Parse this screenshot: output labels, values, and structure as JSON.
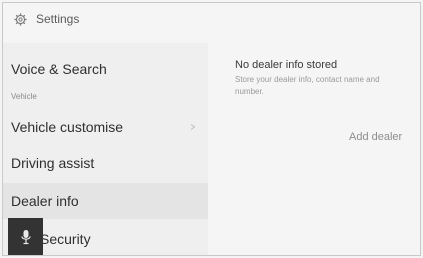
{
  "header": {
    "title": "Settings",
    "icon": "gear-icon"
  },
  "sidebar": {
    "items": [
      {
        "label": "Voice & Search",
        "sublabel": "Vehicle",
        "active": false
      },
      {
        "label": "Vehicle customise",
        "active": false
      },
      {
        "label": "Driving assist",
        "active": false
      },
      {
        "label": "Dealer info",
        "active": true
      },
      {
        "label": "Security",
        "active": false
      }
    ],
    "mic_icon": "microphone-icon"
  },
  "content": {
    "title": "No dealer info stored",
    "description": "Store your dealer info, contact name and number.",
    "add_button": "Add dealer"
  },
  "colors": {
    "background": "#f5f5f5",
    "active_item": "#e4e4e4",
    "mic_button": "#333333"
  }
}
